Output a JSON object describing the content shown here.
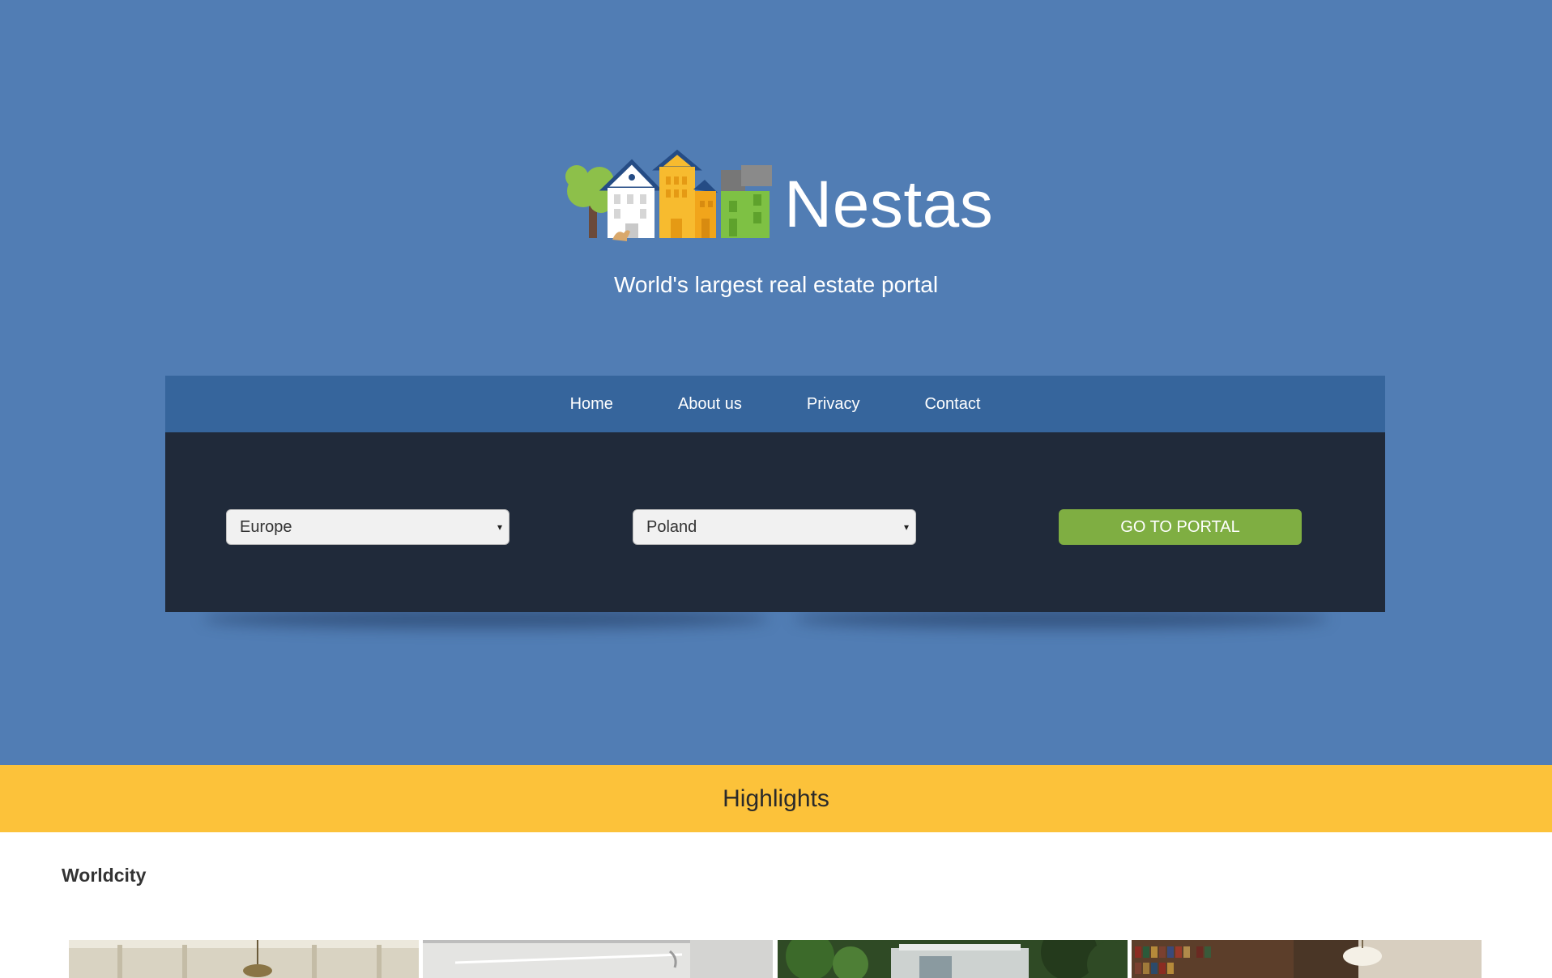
{
  "brand": {
    "name": "Nestas",
    "tagline": "World's largest real estate portal"
  },
  "nav": {
    "items": [
      "Home",
      "About us",
      "Privacy",
      "Contact"
    ]
  },
  "search": {
    "region": "Europe",
    "country": "Poland",
    "button": "GO TO PORTAL"
  },
  "highlights": {
    "title": "Highlights"
  },
  "section": {
    "title": "Worldcity"
  },
  "colors": {
    "hero_bg": "#517db4",
    "nav_bg": "#36659c",
    "panel_bg": "#202a3a",
    "button_bg": "#7fae42",
    "highlight_bg": "#fcc23a"
  },
  "icons": {
    "logo": "houses-and-tree-logo",
    "select_caret": "▾"
  },
  "photos": [
    {
      "name": "interior-chandelier-photo"
    },
    {
      "name": "white-room-photo"
    },
    {
      "name": "garden-house-photo"
    },
    {
      "name": "library-room-photo"
    }
  ]
}
